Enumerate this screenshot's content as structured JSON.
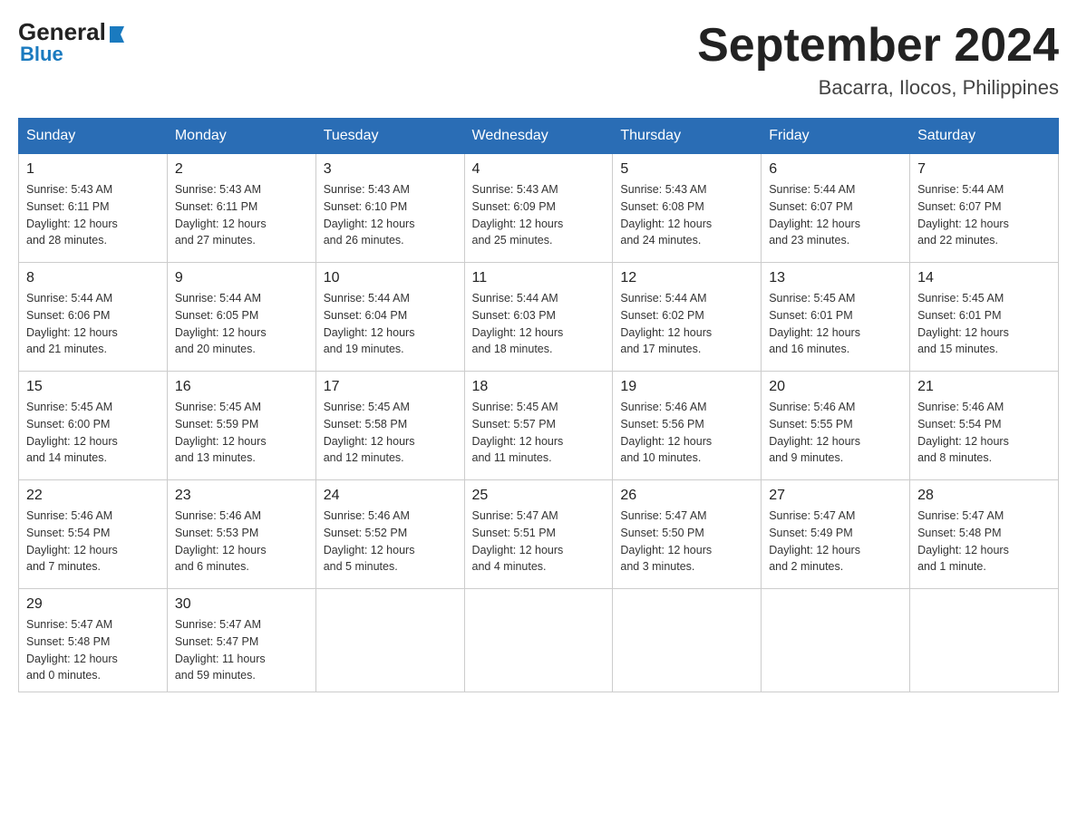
{
  "header": {
    "logo_general": "General",
    "logo_blue": "Blue",
    "title": "September 2024",
    "subtitle": "Bacarra, Ilocos, Philippines"
  },
  "weekdays": [
    "Sunday",
    "Monday",
    "Tuesday",
    "Wednesday",
    "Thursday",
    "Friday",
    "Saturday"
  ],
  "rows": [
    [
      {
        "day": "1",
        "info": "Sunrise: 5:43 AM\nSunset: 6:11 PM\nDaylight: 12 hours\nand 28 minutes."
      },
      {
        "day": "2",
        "info": "Sunrise: 5:43 AM\nSunset: 6:11 PM\nDaylight: 12 hours\nand 27 minutes."
      },
      {
        "day": "3",
        "info": "Sunrise: 5:43 AM\nSunset: 6:10 PM\nDaylight: 12 hours\nand 26 minutes."
      },
      {
        "day": "4",
        "info": "Sunrise: 5:43 AM\nSunset: 6:09 PM\nDaylight: 12 hours\nand 25 minutes."
      },
      {
        "day": "5",
        "info": "Sunrise: 5:43 AM\nSunset: 6:08 PM\nDaylight: 12 hours\nand 24 minutes."
      },
      {
        "day": "6",
        "info": "Sunrise: 5:44 AM\nSunset: 6:07 PM\nDaylight: 12 hours\nand 23 minutes."
      },
      {
        "day": "7",
        "info": "Sunrise: 5:44 AM\nSunset: 6:07 PM\nDaylight: 12 hours\nand 22 minutes."
      }
    ],
    [
      {
        "day": "8",
        "info": "Sunrise: 5:44 AM\nSunset: 6:06 PM\nDaylight: 12 hours\nand 21 minutes."
      },
      {
        "day": "9",
        "info": "Sunrise: 5:44 AM\nSunset: 6:05 PM\nDaylight: 12 hours\nand 20 minutes."
      },
      {
        "day": "10",
        "info": "Sunrise: 5:44 AM\nSunset: 6:04 PM\nDaylight: 12 hours\nand 19 minutes."
      },
      {
        "day": "11",
        "info": "Sunrise: 5:44 AM\nSunset: 6:03 PM\nDaylight: 12 hours\nand 18 minutes."
      },
      {
        "day": "12",
        "info": "Sunrise: 5:44 AM\nSunset: 6:02 PM\nDaylight: 12 hours\nand 17 minutes."
      },
      {
        "day": "13",
        "info": "Sunrise: 5:45 AM\nSunset: 6:01 PM\nDaylight: 12 hours\nand 16 minutes."
      },
      {
        "day": "14",
        "info": "Sunrise: 5:45 AM\nSunset: 6:01 PM\nDaylight: 12 hours\nand 15 minutes."
      }
    ],
    [
      {
        "day": "15",
        "info": "Sunrise: 5:45 AM\nSunset: 6:00 PM\nDaylight: 12 hours\nand 14 minutes."
      },
      {
        "day": "16",
        "info": "Sunrise: 5:45 AM\nSunset: 5:59 PM\nDaylight: 12 hours\nand 13 minutes."
      },
      {
        "day": "17",
        "info": "Sunrise: 5:45 AM\nSunset: 5:58 PM\nDaylight: 12 hours\nand 12 minutes."
      },
      {
        "day": "18",
        "info": "Sunrise: 5:45 AM\nSunset: 5:57 PM\nDaylight: 12 hours\nand 11 minutes."
      },
      {
        "day": "19",
        "info": "Sunrise: 5:46 AM\nSunset: 5:56 PM\nDaylight: 12 hours\nand 10 minutes."
      },
      {
        "day": "20",
        "info": "Sunrise: 5:46 AM\nSunset: 5:55 PM\nDaylight: 12 hours\nand 9 minutes."
      },
      {
        "day": "21",
        "info": "Sunrise: 5:46 AM\nSunset: 5:54 PM\nDaylight: 12 hours\nand 8 minutes."
      }
    ],
    [
      {
        "day": "22",
        "info": "Sunrise: 5:46 AM\nSunset: 5:54 PM\nDaylight: 12 hours\nand 7 minutes."
      },
      {
        "day": "23",
        "info": "Sunrise: 5:46 AM\nSunset: 5:53 PM\nDaylight: 12 hours\nand 6 minutes."
      },
      {
        "day": "24",
        "info": "Sunrise: 5:46 AM\nSunset: 5:52 PM\nDaylight: 12 hours\nand 5 minutes."
      },
      {
        "day": "25",
        "info": "Sunrise: 5:47 AM\nSunset: 5:51 PM\nDaylight: 12 hours\nand 4 minutes."
      },
      {
        "day": "26",
        "info": "Sunrise: 5:47 AM\nSunset: 5:50 PM\nDaylight: 12 hours\nand 3 minutes."
      },
      {
        "day": "27",
        "info": "Sunrise: 5:47 AM\nSunset: 5:49 PM\nDaylight: 12 hours\nand 2 minutes."
      },
      {
        "day": "28",
        "info": "Sunrise: 5:47 AM\nSunset: 5:48 PM\nDaylight: 12 hours\nand 1 minute."
      }
    ],
    [
      {
        "day": "29",
        "info": "Sunrise: 5:47 AM\nSunset: 5:48 PM\nDaylight: 12 hours\nand 0 minutes."
      },
      {
        "day": "30",
        "info": "Sunrise: 5:47 AM\nSunset: 5:47 PM\nDaylight: 11 hours\nand 59 minutes."
      },
      {
        "day": "",
        "info": ""
      },
      {
        "day": "",
        "info": ""
      },
      {
        "day": "",
        "info": ""
      },
      {
        "day": "",
        "info": ""
      },
      {
        "day": "",
        "info": ""
      }
    ]
  ]
}
